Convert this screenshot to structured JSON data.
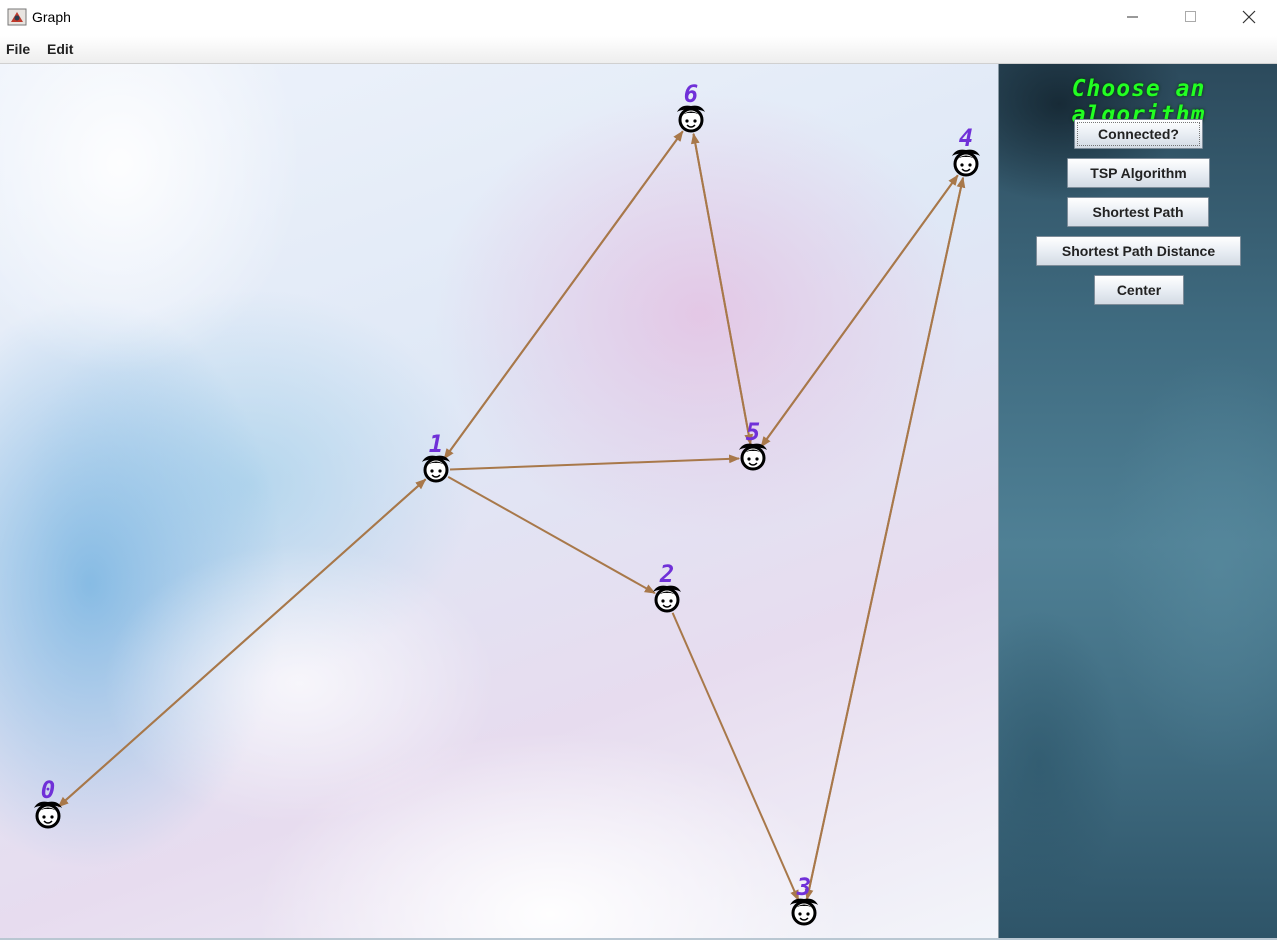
{
  "window": {
    "title": "Graph",
    "minimize_symbol": "—",
    "maximize_symbol": "☐",
    "close_symbol": "✕"
  },
  "menu": {
    "items": [
      {
        "label": "File"
      },
      {
        "label": "Edit"
      }
    ]
  },
  "panel": {
    "title": "Choose an algorithm",
    "buttons": [
      {
        "label": "Connected?"
      },
      {
        "label": "TSP Algorithm"
      },
      {
        "label": "Shortest Path"
      },
      {
        "label": "Shortest Path Distance"
      },
      {
        "label": "Center"
      }
    ]
  },
  "graph": {
    "nodes": [
      {
        "id": "0"
      },
      {
        "id": "1"
      },
      {
        "id": "2"
      },
      {
        "id": "3"
      },
      {
        "id": "4"
      },
      {
        "id": "5"
      },
      {
        "id": "6"
      }
    ],
    "edges": [
      {
        "from": "0",
        "to": "1"
      },
      {
        "from": "1",
        "to": "0"
      },
      {
        "from": "1",
        "to": "5"
      },
      {
        "from": "1",
        "to": "2"
      },
      {
        "from": "1",
        "to": "6"
      },
      {
        "from": "6",
        "to": "1"
      },
      {
        "from": "6",
        "to": "5"
      },
      {
        "from": "5",
        "to": "6"
      },
      {
        "from": "4",
        "to": "5"
      },
      {
        "from": "5",
        "to": "4"
      },
      {
        "from": "2",
        "to": "3"
      },
      {
        "from": "3",
        "to": "4"
      },
      {
        "from": "4",
        "to": "3"
      }
    ],
    "colors": {
      "edge": "#a8784a",
      "node_label": "#7030d8"
    },
    "node_icon": "girl-face-icon"
  }
}
